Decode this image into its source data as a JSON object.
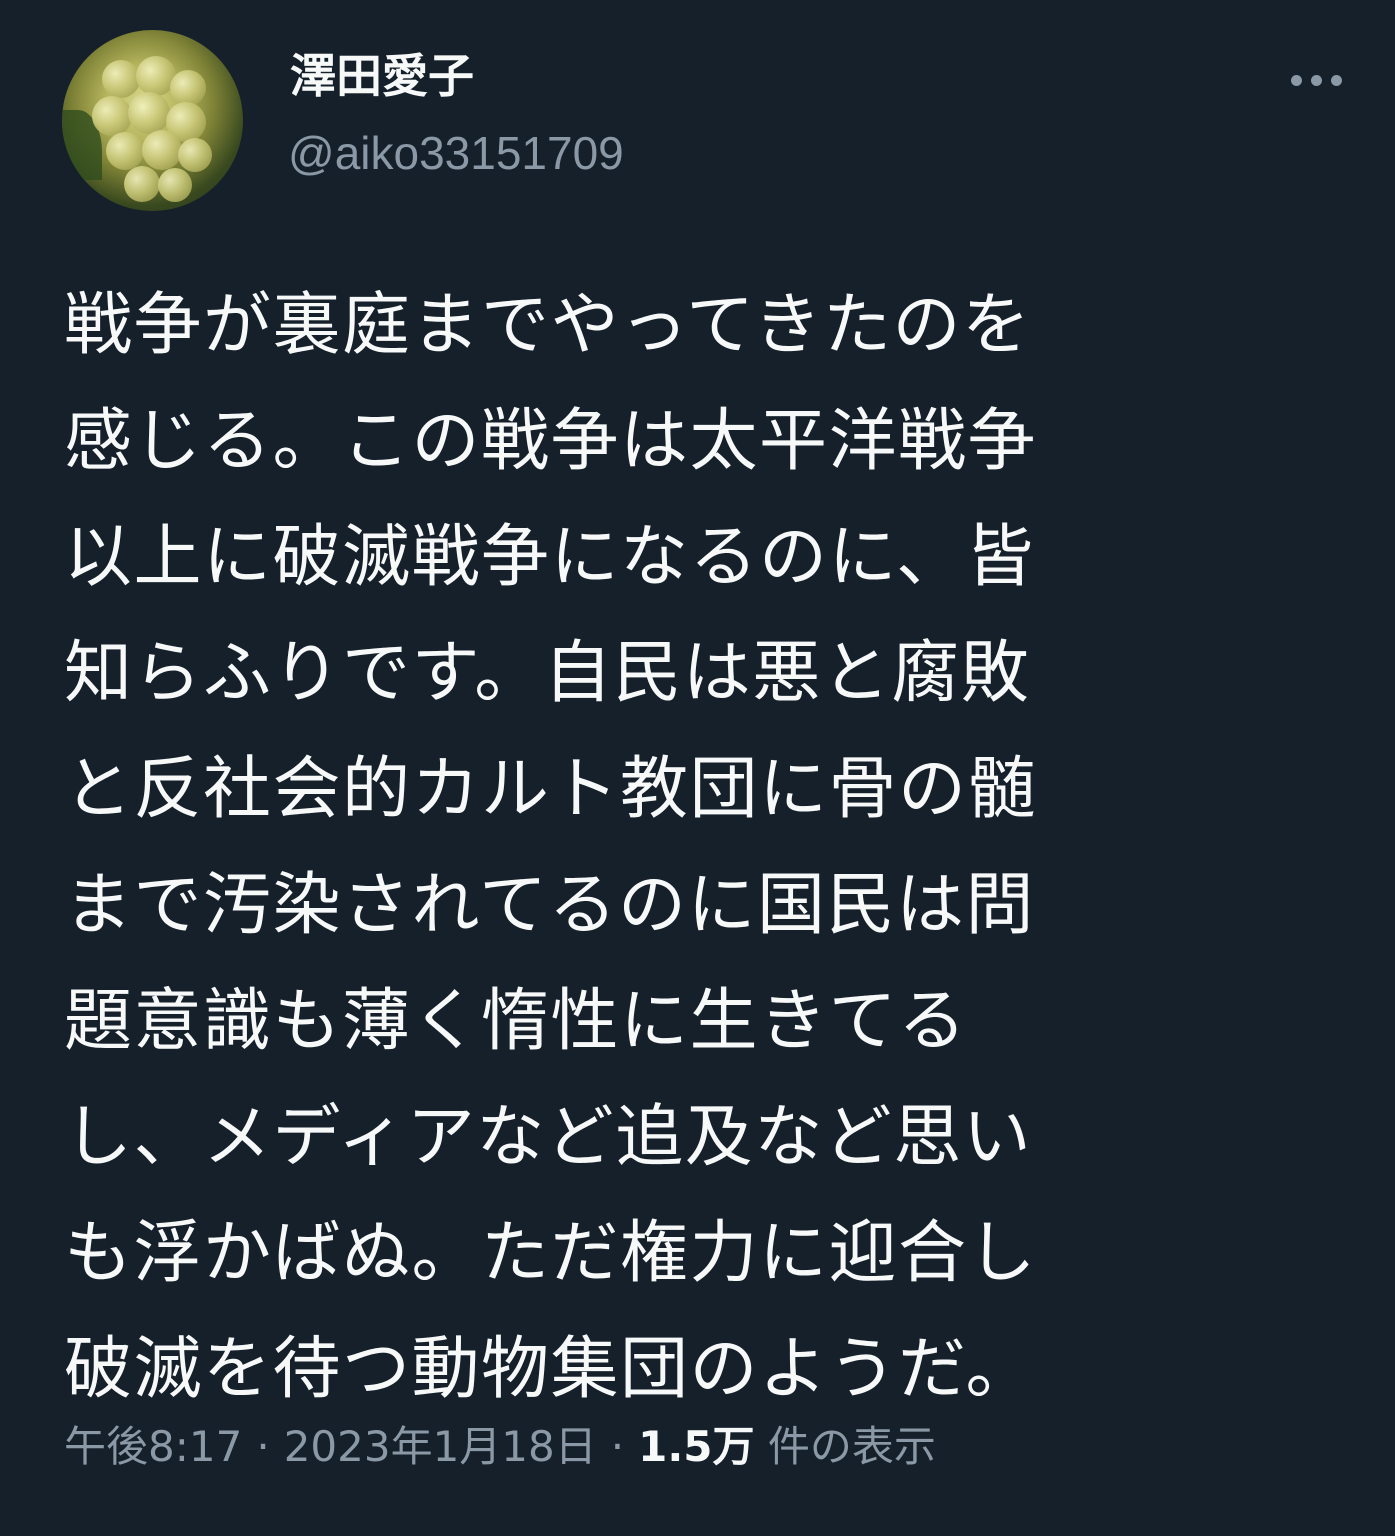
{
  "author": {
    "display_name": "澤田愛子",
    "handle": "@aiko33151709",
    "avatar": "grape-cluster-avatar"
  },
  "tweet": {
    "text_lines": [
      "戦争が裏庭までやってきたのを",
      "感じる。この戦争は太平洋戦争",
      "以上に破滅戦争になるのに、皆",
      "知らふりです。自民は悪と腐敗",
      "と反社会的カルト教団に骨の髄",
      "まで汚染されてるのに国民は問",
      "題意識も薄く惰性に生きてる",
      "し、メディアなど追及など思い",
      "も浮かばぬ。ただ権力に迎合し",
      "破滅を待つ動物集団のようだ。"
    ]
  },
  "meta": {
    "time": "午後8:17",
    "separator": "·",
    "date": "2023年1月18日",
    "views_count": "1.5万",
    "views_label": "件の表示"
  },
  "icons": {
    "more": "more-horizontal-icon"
  },
  "colors": {
    "background": "#15202b",
    "primary_text": "#f7f9f9",
    "secondary_text": "#8b98a5"
  }
}
